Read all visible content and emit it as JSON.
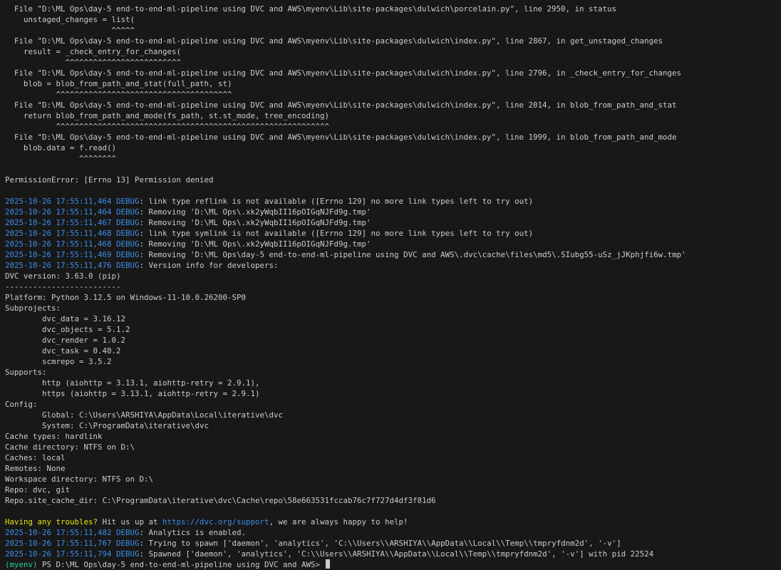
{
  "traceback": [
    "  File \"D:\\ML Ops\\day-5 end-to-end-ml-pipeline using DVC and AWS\\myenv\\Lib\\site-packages\\dulwich\\porcelain.py\", line 2950, in status",
    "    unstaged_changes = list(",
    "                       ^^^^^",
    "  File \"D:\\ML Ops\\day-5 end-to-end-ml-pipeline using DVC and AWS\\myenv\\Lib\\site-packages\\dulwich\\index.py\", line 2867, in get_unstaged_changes",
    "    result = _check_entry_for_changes(",
    "             ^^^^^^^^^^^^^^^^^^^^^^^^^",
    "  File \"D:\\ML Ops\\day-5 end-to-end-ml-pipeline using DVC and AWS\\myenv\\Lib\\site-packages\\dulwich\\index.py\", line 2796, in _check_entry_for_changes",
    "    blob = blob_from_path_and_stat(full_path, st)",
    "           ^^^^^^^^^^^^^^^^^^^^^^^^^^^^^^^^^^^^^^",
    "  File \"D:\\ML Ops\\day-5 end-to-end-ml-pipeline using DVC and AWS\\myenv\\Lib\\site-packages\\dulwich\\index.py\", line 2014, in blob_from_path_and_stat",
    "    return blob_from_path_and_mode(fs_path, st.st_mode, tree_encoding)",
    "           ^^^^^^^^^^^^^^^^^^^^^^^^^^^^^^^^^^^^^^^^^^^^^^^^^^^^^^^^^^^",
    "  File \"D:\\ML Ops\\day-5 end-to-end-ml-pipeline using DVC and AWS\\myenv\\Lib\\site-packages\\dulwich\\index.py\", line 1999, in blob_from_path_and_mode",
    "    blob.data = f.read()",
    "                ^^^^^^^^"
  ],
  "error_message": "PermissionError: [Errno 13] Permission denied",
  "debug_logs_1": [
    {
      "ts": "2025-10-26 17:55:11,464",
      "level": "DEBUG",
      "msg": ": link type reflink is not available ([Errno 129] no more link types left to try out)"
    },
    {
      "ts": "2025-10-26 17:55:11,464",
      "level": "DEBUG",
      "msg": ": Removing 'D:\\ML Ops\\.xk2yWqbII16pOIGqNJFd9g.tmp'"
    },
    {
      "ts": "2025-10-26 17:55:11,467",
      "level": "DEBUG",
      "msg": ": Removing 'D:\\ML Ops\\.xk2yWqbII16pOIGqNJFd9g.tmp'"
    },
    {
      "ts": "2025-10-26 17:55:11,468",
      "level": "DEBUG",
      "msg": ": link type symlink is not available ([Errno 129] no more link types left to try out)"
    },
    {
      "ts": "2025-10-26 17:55:11,468",
      "level": "DEBUG",
      "msg": ": Removing 'D:\\ML Ops\\.xk2yWqbII16pOIGqNJFd9g.tmp'"
    },
    {
      "ts": "2025-10-26 17:55:11,469",
      "level": "DEBUG",
      "msg": ": Removing 'D:\\ML Ops\\day-5 end-to-end-ml-pipeline using DVC and AWS\\.dvc\\cache\\files\\md5\\.SIubg55-uSz_jJKphjfi6w.tmp'"
    },
    {
      "ts": "2025-10-26 17:55:11,476",
      "level": "DEBUG",
      "msg": ": Version info for developers:"
    }
  ],
  "version_info": [
    "DVC version: 3.63.0 (pip)",
    "-------------------------",
    "Platform: Python 3.12.5 on Windows-11-10.0.26200-SP0",
    "Subprojects:",
    "        dvc_data = 3.16.12",
    "        dvc_objects = 5.1.2",
    "        dvc_render = 1.0.2",
    "        dvc_task = 0.40.2",
    "        scmrepo = 3.5.2",
    "Supports:",
    "        http (aiohttp = 3.13.1, aiohttp-retry = 2.9.1),",
    "        https (aiohttp = 3.13.1, aiohttp-retry = 2.9.1)",
    "Config:",
    "        Global: C:\\Users\\ARSHIYA\\AppData\\Local\\iterative\\dvc",
    "        System: C:\\ProgramData\\iterative\\dvc",
    "Cache types: hardlink",
    "Cache directory: NTFS on D:\\",
    "Caches: local",
    "Remotes: None",
    "Workspace directory: NTFS on D:\\",
    "Repo: dvc, git",
    "Repo.site_cache_dir: C:\\ProgramData\\iterative\\dvc\\Cache\\repo\\58e663531fccab76c7f727d4df3f81d6"
  ],
  "help": {
    "highlight": "Having any troubles?",
    "before_link": " Hit us up at ",
    "link": "https://dvc.org/support",
    "after_link": ", we are always happy to help!"
  },
  "debug_logs_2": [
    {
      "ts": "2025-10-26 17:55:11,482",
      "level": "DEBUG",
      "msg": ": Analytics is enabled."
    },
    {
      "ts": "2025-10-26 17:55:11,767",
      "level": "DEBUG",
      "msg": ": Trying to spawn ['daemon', 'analytics', 'C:\\\\Users\\\\ARSHIYA\\\\AppData\\\\Local\\\\Temp\\\\tmpryfdnm2d', '-v']"
    },
    {
      "ts": "2025-10-26 17:55:11,794",
      "level": "DEBUG",
      "msg": ": Spawned ['daemon', 'analytics', 'C:\\\\Users\\\\ARSHIYA\\\\AppData\\\\Local\\\\Temp\\\\tmpryfdnm2d', '-v'] with pid 22524"
    }
  ],
  "prompt": {
    "env": "(myenv)",
    "path": " PS D:\\ML Ops\\day-5 end-to-end-ml-pipeline using DVC and AWS> "
  },
  "colors": {
    "background": "#181818",
    "text": "#cccccc",
    "timestamp": "#3b8eea",
    "highlight": "#e5e510",
    "env": "#23d18b"
  }
}
